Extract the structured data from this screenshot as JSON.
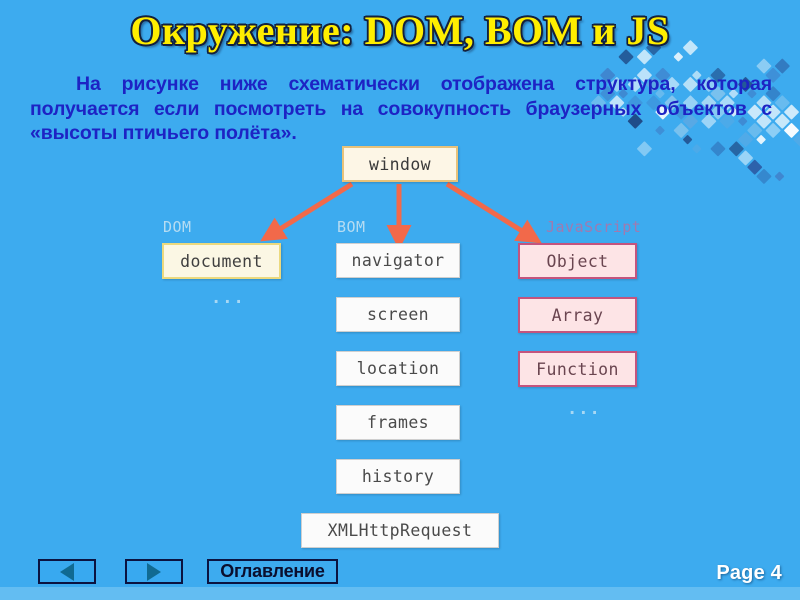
{
  "slide": {
    "title": "Окружение: DOM, BOM и JS",
    "body_text": "На рисунке ниже схематически отображена структура, которая получается если посмотреть на совокупность браузерных объектов с «высоты птичьего полёта».",
    "background_color": "#3dabef",
    "title_color": "#ffee00",
    "body_color": "#1d23c4"
  },
  "diagram": {
    "root": {
      "label": "window"
    },
    "columns": [
      {
        "id": "dom",
        "label": "DOM",
        "label_color": "#b6dcf2",
        "accent_color": "#ebd97e",
        "nodes": [
          {
            "label": "document"
          }
        ],
        "ellipsis": "..."
      },
      {
        "id": "bom",
        "label": "BOM",
        "label_color": "#b6dcf2",
        "accent_color": "#cfcfcf",
        "nodes": [
          {
            "label": "navigator"
          },
          {
            "label": "screen"
          },
          {
            "label": "location"
          },
          {
            "label": "frames"
          },
          {
            "label": "history"
          }
        ],
        "ellipsis": ""
      },
      {
        "id": "javascript",
        "label": "JavaScript",
        "label_color": "#a07ab0",
        "accent_color": "#c4547e",
        "nodes": [
          {
            "label": "Object"
          },
          {
            "label": "Array"
          },
          {
            "label": "Function"
          }
        ],
        "ellipsis": "..."
      }
    ],
    "wide_node": {
      "label": "XMLHttpRequest"
    },
    "arrow_color": "#f2694a"
  },
  "footer": {
    "prev_label": "",
    "next_label": "",
    "toc_label": "Оглавление",
    "page_label": "Page 4"
  }
}
